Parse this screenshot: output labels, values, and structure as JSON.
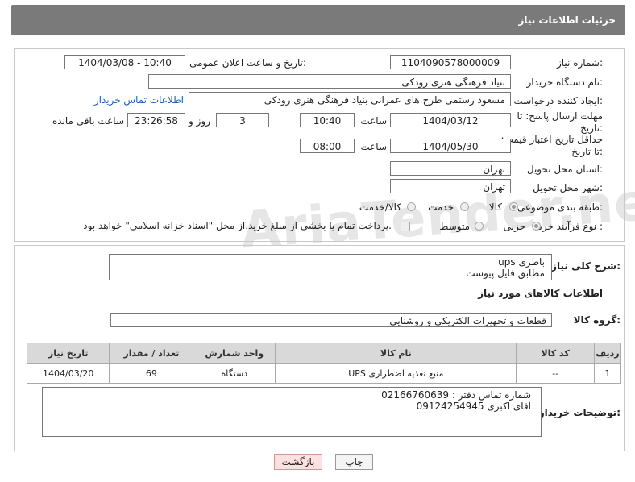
{
  "header": {
    "title": "جزئیات اطلاعات نیاز"
  },
  "watermark": "AriaTender.neT",
  "form": {
    "need_number_label": "شماره نیاز:",
    "need_number": "1104090578000009",
    "announce_label": "تاریخ و ساعت اعلان عمومی:",
    "announce_value": "1404/03/08 - 10:40",
    "buyer_org_label": "نام دستگاه خریدار:",
    "buyer_org": "بنیاد فرهنگی هنری رودکی",
    "creator_label": "ایجاد کننده درخواست:",
    "creator": "مسعود رستمی طرح های عمرانی بنیاد فرهنگی هنری رودکی",
    "contact_link": "اطلاعات تماس خریدار",
    "deadline_label": "مهلت ارسال پاسخ: تا تاریخ:",
    "deadline_date": "1404/03/12",
    "time_label": "ساعت",
    "deadline_time": "10:40",
    "days_value": "3",
    "days_label": "روز و",
    "remaining_time": "23:26:58",
    "remaining_label": "ساعت باقی مانده",
    "validity_label": "حداقل تاریخ اعتبار قیمت: تا تاریخ:",
    "validity_date": "1404/05/30",
    "validity_time": "08:00",
    "province_label": "استان محل تحویل:",
    "province": "تهران",
    "city_label": "شهر محل تحویل:",
    "city": "تهران",
    "category_label": "طبقه بندی موضوعی:",
    "category_options": [
      "کالا",
      "خدمت",
      "کالا/خدمت"
    ],
    "process_label": "نوع فرآیند خرید :",
    "process_options": [
      "جزیی",
      "متوسط"
    ],
    "payment_note": "پرداخت تمام یا بخشی از مبلغ خرید،از محل \"اسناد خزانه اسلامی\" خواهد بود."
  },
  "description": {
    "label": "شرح کلی نیاز:",
    "line1": "باطری ups",
    "line2": "مطابق فایل پیوست"
  },
  "goods": {
    "section_title": "اطلاعات کالاهای مورد نیاز",
    "group_label": "گروه کالا:",
    "group_value": "قطعات و تجهیزات الکتریکی و روشنایی",
    "columns": [
      "ردیف",
      "کد کالا",
      "نام کالا",
      "واحد شمارش",
      "تعداد / مقدار",
      "تاریخ نیاز"
    ],
    "rows": [
      {
        "row": "1",
        "code": "--",
        "name": "منبع تغذیه اضطراری UPS",
        "unit": "دستگاه",
        "qty": "69",
        "date": "1404/03/20"
      }
    ]
  },
  "buyer_notes": {
    "label": "توضیحات خریدار:",
    "line1": "شماره تماس دفتر :  02166760639",
    "line2": "آقای اکبری 09124254945"
  },
  "buttons": {
    "print": "چاپ",
    "back": "بازگشت"
  }
}
